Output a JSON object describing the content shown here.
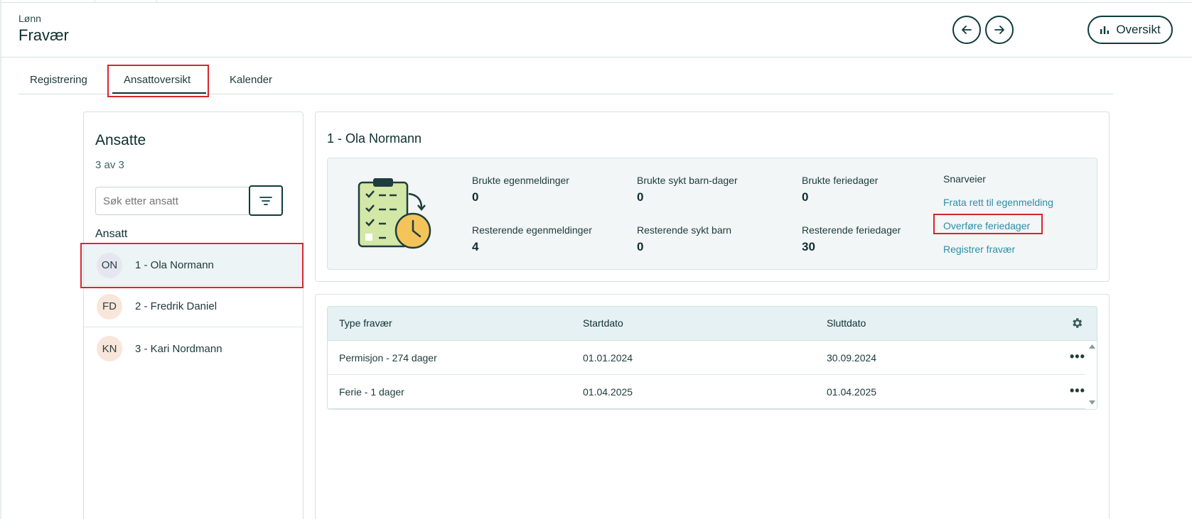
{
  "header": {
    "breadcrumb": "Lønn",
    "title": "Fravær",
    "overview_label": "Oversikt"
  },
  "tabs": [
    {
      "label": "Registrering"
    },
    {
      "label": "Ansattoversikt"
    },
    {
      "label": "Kalender"
    }
  ],
  "employees": {
    "title": "Ansatte",
    "count": "3 av 3",
    "search_placeholder": "Søk etter ansatt",
    "column_label": "Ansatt",
    "items": [
      {
        "initials": "ON",
        "name": "1 - Ola Normann"
      },
      {
        "initials": "FD",
        "name": "2 - Fredrik Daniel"
      },
      {
        "initials": "KN",
        "name": "3 - Kari Nordmann"
      }
    ]
  },
  "detail": {
    "title": "1 - Ola Normann",
    "stats": [
      {
        "label": "Brukte egenmeldinger",
        "value": "0"
      },
      {
        "label": "Brukte sykt barn-dager",
        "value": "0"
      },
      {
        "label": "Brukte feriedager",
        "value": "0"
      },
      {
        "label": "Resterende egenmeldinger",
        "value": "4"
      },
      {
        "label": "Resterende sykt barn",
        "value": "0"
      },
      {
        "label": "Resterende feriedager",
        "value": "30"
      }
    ],
    "shortcuts": {
      "title": "Snarveier",
      "links": [
        "Frata rett til egenmelding",
        "Overføre feriedager",
        "Registrer fravær"
      ]
    }
  },
  "absence_table": {
    "headers": [
      "Type fravær",
      "Startdato",
      "Sluttdato"
    ],
    "rows": [
      {
        "type": "Permisjon - 274 dager",
        "start": "01.01.2024",
        "end": "30.09.2024"
      },
      {
        "type": "Ferie - 1 dager",
        "start": "01.04.2025",
        "end": "01.04.2025"
      }
    ]
  },
  "colors": {
    "primary": "#0f3a3c",
    "link": "#2a8fa8",
    "highlight": "#d9262c",
    "selected_row": "#edf4f5"
  }
}
